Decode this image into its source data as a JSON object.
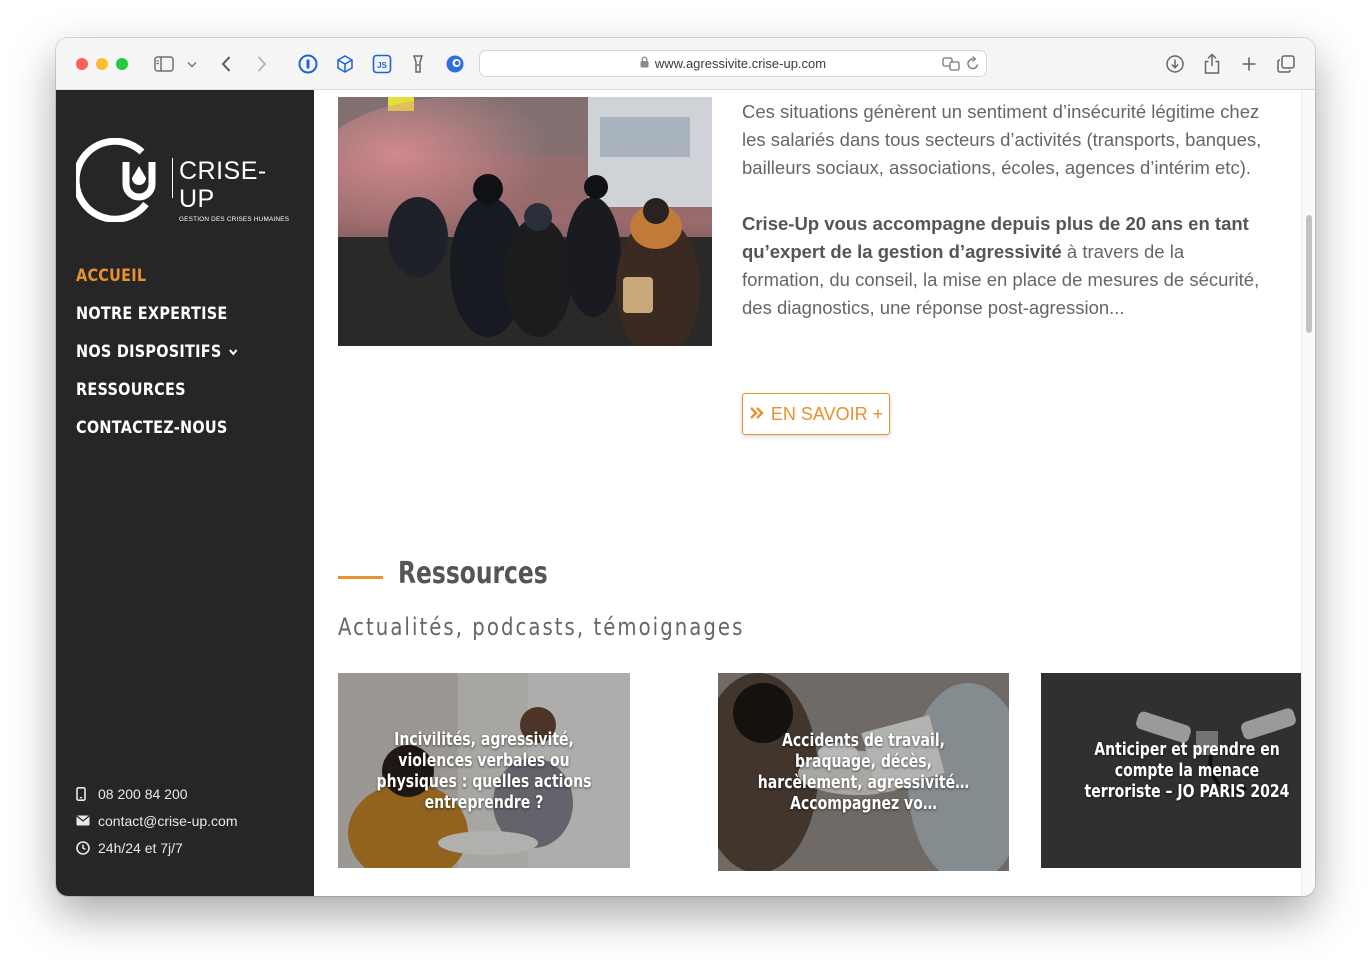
{
  "browser": {
    "url": "www.agressivite.crise-up.com"
  },
  "logo": {
    "title": "CRISE-UP",
    "subtitle": "GESTION DES CRISES HUMAINES"
  },
  "nav": {
    "items": [
      {
        "label": "ACCUEIL",
        "active": true
      },
      {
        "label": "NOTRE EXPERTISE"
      },
      {
        "label": "NOS DISPOSITIFS"
      },
      {
        "label": "RESSOURCES"
      },
      {
        "label": "CONTACTEZ-NOUS"
      }
    ]
  },
  "contact": {
    "phone": "08 200 84 200",
    "email": "contact@crise-up.com",
    "hours": "24h/24 et 7j/7"
  },
  "intro": {
    "paragraph1": "Ces situations génèrent un sentiment d’insécurité légitime chez les salariés dans tous secteurs d’activités (transports, banques, bailleurs sociaux, associations, écoles, agences d’intérim etc).",
    "bold": "Crise-Up vous accompagne depuis plus de 20 ans en tant qu’expert de la gestion d’agressivité",
    "rest": " à travers de la formation, du conseil, la mise en place de mesures de sécurité, des diagnostics, une réponse post-agression..."
  },
  "cta": {
    "label": "EN SAVOIR +"
  },
  "resources": {
    "title": "Ressources",
    "subtitle": "Actualités, podcasts, témoignages",
    "cards": [
      {
        "title": "Incivilités, agressivité, violences verbales ou physiques : quelles actions entreprendre ?"
      },
      {
        "title": "Accidents de travail, braquage, décès, harcèlement, agressivité… Accompagnez vo…"
      },
      {
        "title": "Anticiper et prendre en compte la menace terroriste – JO PARIS 2024"
      }
    ]
  },
  "colors": {
    "accent": "#e8912d",
    "sidebar": "#262626"
  }
}
